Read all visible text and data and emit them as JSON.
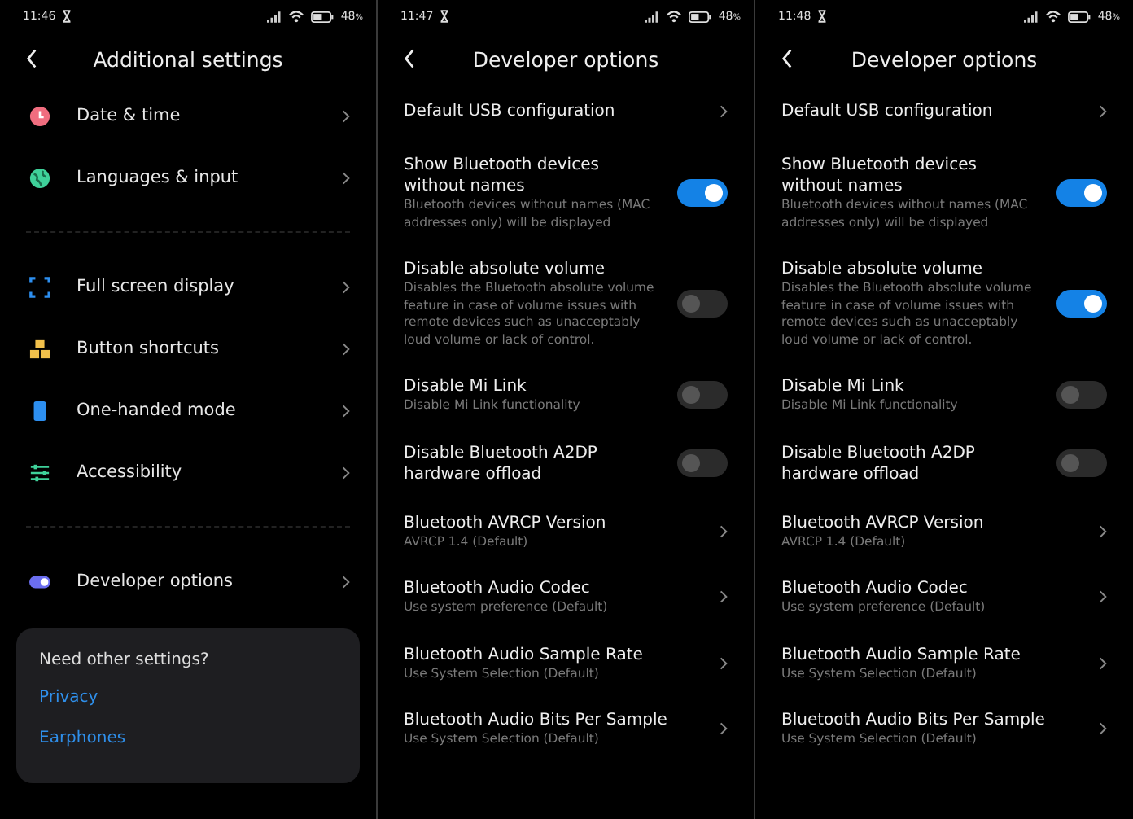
{
  "screens": [
    {
      "kind": "menu",
      "time": "11:46",
      "battery": "48",
      "battery_unit": "%",
      "title": "Additional settings",
      "groups": [
        [
          {
            "label": "Date & time"
          },
          {
            "label": "Languages & input"
          }
        ],
        [
          {
            "label": "Full screen display"
          },
          {
            "label": "Button shortcuts"
          },
          {
            "label": "One-handed mode"
          },
          {
            "label": "Accessibility"
          }
        ],
        [
          {
            "label": "Developer options"
          }
        ]
      ],
      "card": {
        "heading": "Need other settings?",
        "links": [
          "Privacy",
          "Earphones"
        ]
      }
    },
    {
      "kind": "developer",
      "time": "11:47",
      "battery": "48",
      "battery_unit": "%",
      "title": "Developer options",
      "items": [
        {
          "kind": "link",
          "title": "Default USB configuration"
        },
        {
          "kind": "toggle",
          "title": "Show Bluetooth devices without names",
          "subtitle": "Bluetooth devices without names (MAC addresses only) will be displayed",
          "on": true
        },
        {
          "kind": "toggle",
          "title": "Disable absolute volume",
          "subtitle": "Disables the Bluetooth absolute volume feature in case of volume issues with remote devices such as unacceptably loud volume or lack of control.",
          "on": false
        },
        {
          "kind": "toggle",
          "title": "Disable Mi Link",
          "subtitle": "Disable Mi Link functionality",
          "on": false
        },
        {
          "kind": "toggle",
          "title": "Disable Bluetooth A2DP hardware offload",
          "on": false
        },
        {
          "kind": "link",
          "title": "Bluetooth AVRCP Version",
          "subtitle": "AVRCP 1.4 (Default)"
        },
        {
          "kind": "link",
          "title": "Bluetooth Audio Codec",
          "subtitle": "Use system preference (Default)"
        },
        {
          "kind": "link",
          "title": "Bluetooth Audio Sample Rate",
          "subtitle": "Use System Selection (Default)"
        },
        {
          "kind": "link",
          "title": "Bluetooth Audio Bits Per Sample",
          "subtitle": "Use System Selection (Default)"
        }
      ]
    },
    {
      "kind": "developer",
      "time": "11:48",
      "battery": "48",
      "battery_unit": "%",
      "title": "Developer options",
      "items": [
        {
          "kind": "link",
          "title": "Default USB configuration"
        },
        {
          "kind": "toggle",
          "title": "Show Bluetooth devices without names",
          "subtitle": "Bluetooth devices without names (MAC addresses only) will be displayed",
          "on": true
        },
        {
          "kind": "toggle",
          "title": "Disable absolute volume",
          "subtitle": "Disables the Bluetooth absolute volume feature in case of volume issues with remote devices such as unacceptably loud volume or lack of control.",
          "on": true
        },
        {
          "kind": "toggle",
          "title": "Disable Mi Link",
          "subtitle": "Disable Mi Link functionality",
          "on": false
        },
        {
          "kind": "toggle",
          "title": "Disable Bluetooth A2DP hardware offload",
          "on": false
        },
        {
          "kind": "link",
          "title": "Bluetooth AVRCP Version",
          "subtitle": "AVRCP 1.4 (Default)"
        },
        {
          "kind": "link",
          "title": "Bluetooth Audio Codec",
          "subtitle": "Use system preference (Default)"
        },
        {
          "kind": "link",
          "title": "Bluetooth Audio Sample Rate",
          "subtitle": "Use System Selection (Default)"
        },
        {
          "kind": "link",
          "title": "Bluetooth Audio Bits Per Sample",
          "subtitle": "Use System Selection (Default)"
        }
      ]
    }
  ]
}
